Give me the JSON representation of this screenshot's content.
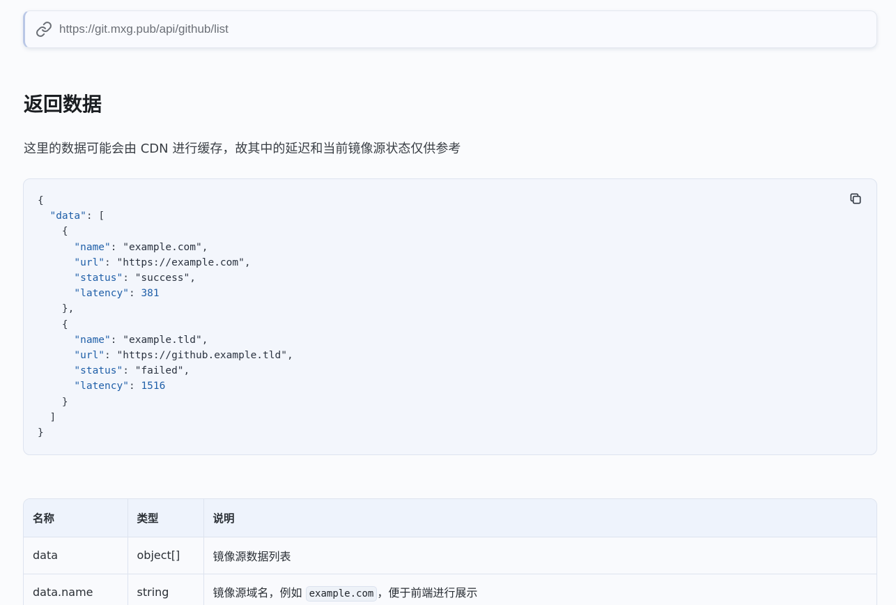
{
  "api": {
    "url": "https://git.mxg.pub/api/github/list",
    "icon": "link-icon"
  },
  "response_section": {
    "title": "返回数据",
    "description": "这里的数据可能会由 CDN 进行缓存，故其中的延迟和当前镜像源状态仅供参考"
  },
  "code_example": {
    "copy_icon": "copy-icon",
    "key_data": "\"data\"",
    "items": [
      {
        "name_key": "\"name\"",
        "name": "\"example.com\"",
        "url_key": "\"url\"",
        "url": "\"https://example.com\"",
        "status_key": "\"status\"",
        "status": "\"success\"",
        "latency_key": "\"latency\"",
        "latency": "381"
      },
      {
        "name_key": "\"name\"",
        "name": "\"example.tld\"",
        "url_key": "\"url\"",
        "url": "\"https://github.example.tld\"",
        "status_key": "\"status\"",
        "status": "\"failed\"",
        "latency_key": "\"latency\"",
        "latency": "1516"
      }
    ]
  },
  "table": {
    "headers": [
      "名称",
      "类型",
      "说明"
    ],
    "rows": [
      {
        "name": "data",
        "type": "object[]",
        "desc": "镜像源数据列表"
      },
      {
        "name": "data.name",
        "type": "string",
        "desc_before": "镜像源域名，例如",
        "desc_code": "example.com",
        "desc_after": "，便于前端进行展示"
      }
    ]
  },
  "colors": {
    "accent": "#1f5fa8",
    "background": "#fafbfd",
    "code_background": "#f3f6fc",
    "table_header": "#eef3fc"
  }
}
